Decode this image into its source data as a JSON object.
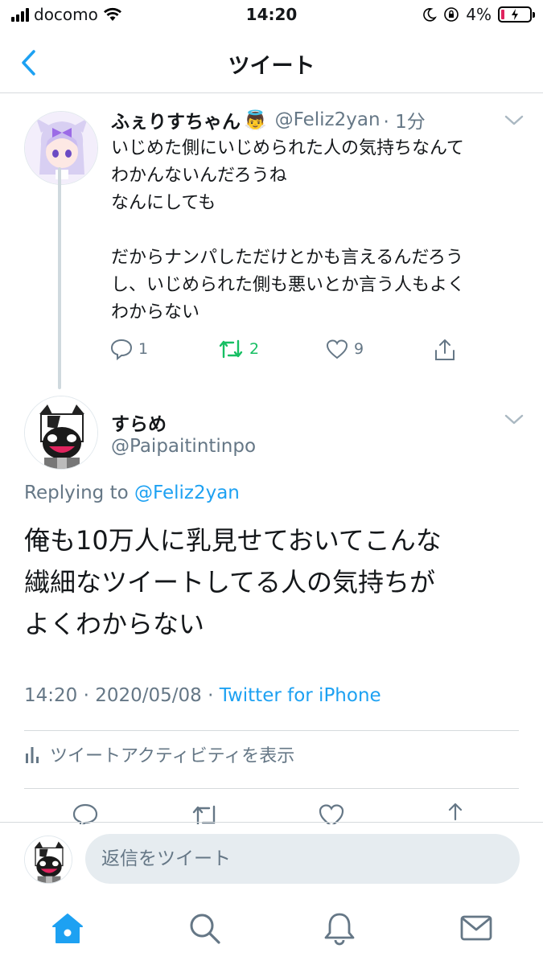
{
  "status_bar": {
    "carrier": "docomo",
    "time": "14:20",
    "battery": "4%"
  },
  "nav": {
    "title": "ツイート"
  },
  "parent_tweet": {
    "name": "ふぇりすちゃん",
    "name_emoji": "👼",
    "handle": "@Feliz2yan",
    "time": "· 1分",
    "body": "いじめた側にいじめられた人の気持ちなんて\nわかんないんだろうね\nなんにしても\n\nだからナンパしただけとかも言えるんだろう\nし、いじめられた側も悪いとか言う人もよく\nわからない",
    "reply_count": "1",
    "retweet_count": "2",
    "like_count": "9"
  },
  "main_tweet": {
    "name": "すらめ",
    "handle": "@Paipaitintinpo",
    "replying_prefix": "Replying to",
    "replying_handle": "@Feliz2yan",
    "body": "俺も10万人に乳見せておいてこんな\n繊細なツイートしてる人の気持ちが\nよくわからない",
    "timestamp": "14:20 · 2020/05/08 · ",
    "source": "Twitter for iPhone",
    "activity_label": "ツイートアクティビティを表示"
  },
  "reply_bar": {
    "placeholder": "返信をツイート"
  },
  "colors": {
    "accent": "#1da1f2",
    "retweet": "#17bf63",
    "muted": "#657786"
  },
  "icons": [
    "back-icon",
    "chevron-down-icon",
    "reply-icon",
    "retweet-icon",
    "like-icon",
    "share-icon",
    "activity-icon",
    "home-icon",
    "search-icon",
    "notifications-icon",
    "messages-icon"
  ]
}
